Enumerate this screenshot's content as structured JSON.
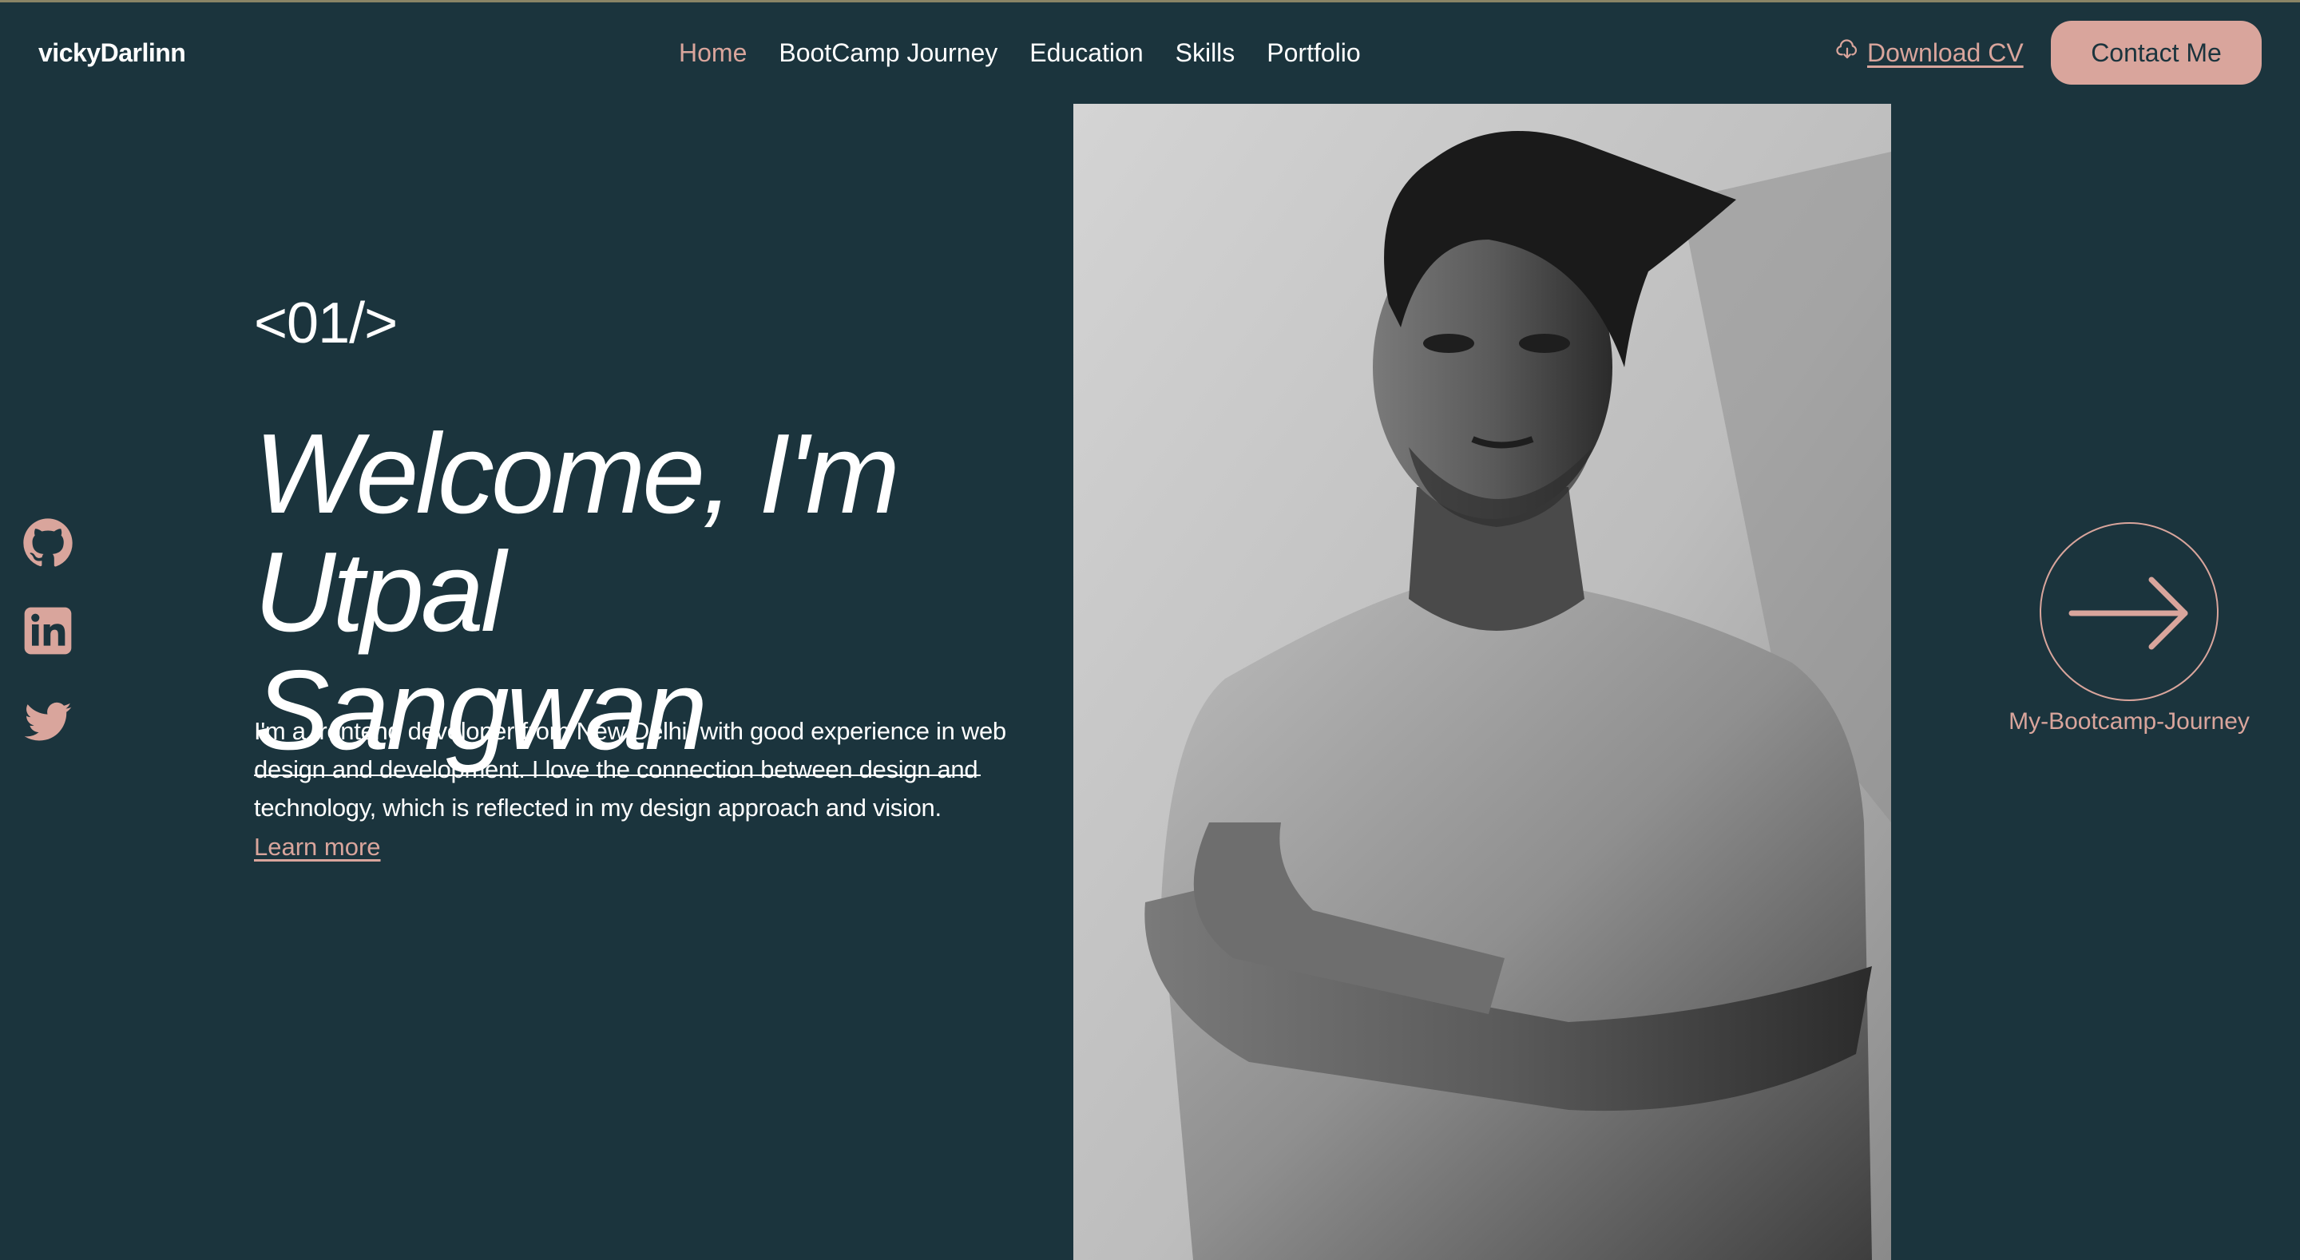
{
  "header": {
    "brand": "vickyDarlinn",
    "nav": [
      {
        "label": "Home",
        "active": true
      },
      {
        "label": "BootCamp Journey",
        "active": false
      },
      {
        "label": "Education",
        "active": false
      },
      {
        "label": "Skills",
        "active": false
      },
      {
        "label": "Portfolio",
        "active": false
      }
    ],
    "download_cv": "Download CV",
    "contact_button": "Contact Me"
  },
  "socials": [
    {
      "icon": "github-icon"
    },
    {
      "icon": "linkedin-icon"
    },
    {
      "icon": "twitter-icon"
    }
  ],
  "hero": {
    "tag": "<01/>",
    "headline_line1": "Welcome, I'm",
    "headline_line2": "Utpal Sangwan",
    "intro": "I'm a frontend developer from New Delhi, with good experience in web design and development. I love the connection between design and technology, which is reflected in my design approach and vision.",
    "learn_more": "Learn more"
  },
  "next": {
    "icon": "arrow-right-icon",
    "label": "My-Bootcamp-Journey"
  },
  "colors": {
    "background": "#1b343d",
    "accent": "#d9a59c",
    "text": "#ffffff"
  }
}
